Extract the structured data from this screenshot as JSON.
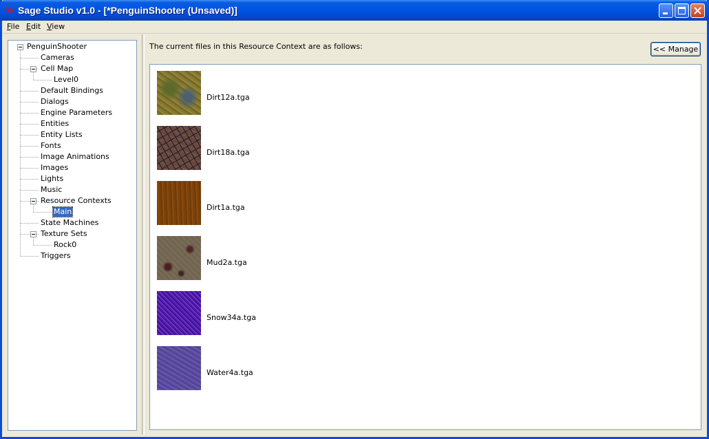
{
  "window": {
    "app_icon": "SS",
    "title": "Sage Studio v1.0 - [*PenguinShooter (Unsaved)]",
    "controls": [
      "minimize-icon",
      "maximize-icon",
      "close-icon"
    ]
  },
  "menu": [
    {
      "label": "File"
    },
    {
      "label": "Edit"
    },
    {
      "label": "View"
    }
  ],
  "tree": {
    "root": "PenguinShooter",
    "items": [
      {
        "label": "Cameras",
        "level": 1
      },
      {
        "label": "Cell Map",
        "level": 1,
        "expanded": true
      },
      {
        "label": "Level0",
        "level": 2
      },
      {
        "label": "Default Bindings",
        "level": 1
      },
      {
        "label": "Dialogs",
        "level": 1
      },
      {
        "label": "Engine Parameters",
        "level": 1
      },
      {
        "label": "Entities",
        "level": 1
      },
      {
        "label": "Entity Lists",
        "level": 1
      },
      {
        "label": "Fonts",
        "level": 1
      },
      {
        "label": "Image Animations",
        "level": 1
      },
      {
        "label": "Images",
        "level": 1
      },
      {
        "label": "Lights",
        "level": 1
      },
      {
        "label": "Music",
        "level": 1
      },
      {
        "label": "Resource Contexts",
        "level": 1,
        "expanded": true
      },
      {
        "label": "Main",
        "level": 2,
        "selected": true
      },
      {
        "label": "State Machines",
        "level": 1
      },
      {
        "label": "Texture Sets",
        "level": 1,
        "expanded": true
      },
      {
        "label": "Rock0",
        "level": 2
      },
      {
        "label": "Triggers",
        "level": 1
      }
    ]
  },
  "main": {
    "caption": "The current files in this Resource Context are as follows:",
    "manage_button": "<< Manage",
    "files": [
      {
        "name": "Dirt12a.tga",
        "thumb": "thumb-dirt12a"
      },
      {
        "name": "Dirt18a.tga",
        "thumb": "thumb-dirt18a"
      },
      {
        "name": "Dirt1a.tga",
        "thumb": "thumb-dirt1a"
      },
      {
        "name": "Mud2a.tga",
        "thumb": "thumb-mud2a"
      },
      {
        "name": "Snow34a.tga",
        "thumb": "thumb-snow34a"
      },
      {
        "name": "Water4a.tga",
        "thumb": "thumb-water4a"
      }
    ]
  },
  "colors": {
    "title_bar": "#0054e3",
    "selection": "#316ac5",
    "window_bg": "#ece9d8",
    "border": "#7f9db9"
  }
}
